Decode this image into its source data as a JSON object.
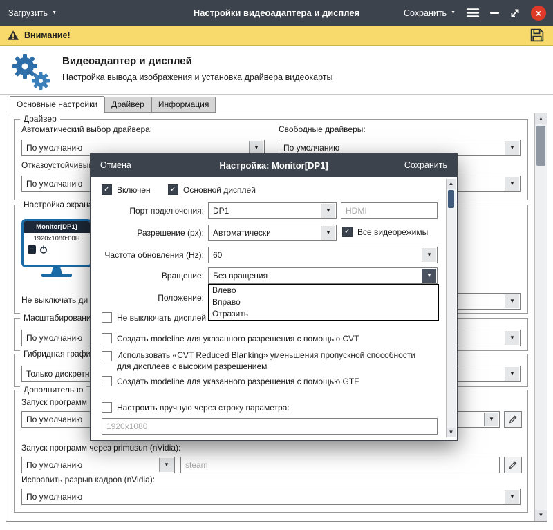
{
  "colors": {
    "titlebar_bg": "#3c434d",
    "warning_bg": "#f8d96b",
    "accent_blue": "#2d6ea8",
    "monitor_blue": "#1a6aa5",
    "close_red": "#dd3b27"
  },
  "glyphs": {
    "caret": "▼",
    "check": "✓",
    "up": "▲",
    "down": "▼",
    "minus": "–",
    "close": "×"
  },
  "titlebar": {
    "load": "Загрузить",
    "title": "Настройки видеоадаптера и дисплея",
    "save": "Сохранить"
  },
  "warning": {
    "text": "Внимание!"
  },
  "header": {
    "title": "Видеоадаптер и дисплей",
    "subtitle": "Настройка вывода изображения и установка драйвера видеокарты"
  },
  "tabs": [
    {
      "label": "Основные настройки"
    },
    {
      "label": "Драйвер"
    },
    {
      "label": "Информация"
    }
  ],
  "main": {
    "driver": {
      "legend": "Драйвер",
      "auto_label": "Автоматический выбор драйвера:",
      "auto_value": "По умолчанию",
      "free_label": "Свободные драйверы:",
      "free_value": "По умолчанию",
      "failsafe_label": "Отказоустойчивый",
      "failsafe_value": "По умолчанию",
      "extra_value": ""
    },
    "screen": {
      "legend": "Настройка экрана",
      "monitor_name": "Monitor[DP1]",
      "monitor_mode": "1920x1080:60H",
      "dpms_label": "Не выключать ди",
      "dpms_value": ""
    },
    "scaling": {
      "legend": "Масштабирование",
      "value": "По умолчанию"
    },
    "hybrid": {
      "legend": "Гибридная графика",
      "value": "Только дискретно"
    },
    "extra": {
      "legend": "Дополнительно",
      "run1_label": "Запуск программ ч",
      "run1_value": "По умолчанию",
      "run2_label": "Запуск программ через primusun (nVidia):",
      "run2_value": "По умолчанию",
      "run2_placeholder": "steam",
      "tear_label": "Исправить разрыв кадров (nVidia):",
      "tear_value": "По умолчанию"
    }
  },
  "modal": {
    "cancel": "Отмена",
    "title": "Настройка: Monitor[DP1]",
    "save": "Сохранить",
    "enabled": "Включен",
    "primary": "Основной дисплей",
    "port_label": "Порт подключения:",
    "port_value": "DP1",
    "port_placeholder": "HDMI",
    "res_label": "Разрешение (px):",
    "res_value": "Автоматически",
    "all_modes": "Все видеорежимы",
    "hz_label": "Частота обновления (Hz):",
    "hz_value": "60",
    "rot_label": "Вращение:",
    "rot_value": "Без вращения",
    "rotation_options": [
      "Влево",
      "Вправо",
      "Отразить"
    ],
    "pos_label": "Положение:",
    "pos_value": "",
    "dpms": "Не выключать дисплей",
    "cvt": "Создать modeline для указанного разрешения с помощью CVT",
    "rb_line1": "Использовать «CVT Reduced Blanking» уменьшения пропускной способности",
    "rb_line2": "для дисплеев с высоким разрешением",
    "gtf": "Создать modeline для указанного разрешения с помощью GTF",
    "manual": "Настроить вручную через строку параметра:",
    "manual_placeholder": "1920x1080"
  }
}
